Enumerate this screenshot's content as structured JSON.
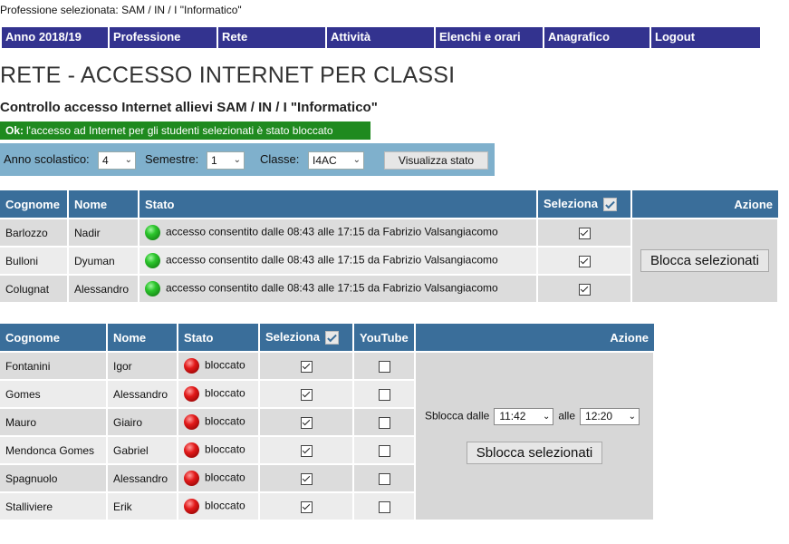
{
  "header": {
    "profession_info": "Professione selezionata: SAM / IN / I  \"Informatico\""
  },
  "nav": [
    {
      "label": "Anno 2018/19"
    },
    {
      "label": "Professione"
    },
    {
      "label": "Rete"
    },
    {
      "label": "Attività"
    },
    {
      "label": "Elenchi e orari"
    },
    {
      "label": "Anagrafico"
    },
    {
      "label": "Logout"
    }
  ],
  "page": {
    "title": "RETE - ACCESSO INTERNET PER CLASSI",
    "subtitle": "Controllo accesso Internet allievi SAM / IN / I  \"Informatico\"",
    "ok_prefix": "Ok:",
    "ok_message": "l'accesso ad Internet per gli studenti selezionati è stato bloccato"
  },
  "filters": {
    "anno_label": "Anno scolastico:",
    "anno_value": "4",
    "semestre_label": "Semestre:",
    "semestre_value": "1",
    "classe_label": "Classe:",
    "classe_value": "I4AC",
    "view_button": "Visualizza stato"
  },
  "allowed_table": {
    "headers": {
      "cognome": "Cognome",
      "nome": "Nome",
      "stato": "Stato",
      "seleziona": "Seleziona",
      "azione": "Azione"
    },
    "rows": [
      {
        "cognome": "Barlozzo",
        "nome": "Nadir",
        "stato": "accesso consentito dalle 08:43 alle 17:15 da Fabrizio Valsangiacomo",
        "checked": true
      },
      {
        "cognome": "Bulloni",
        "nome": "Dyuman",
        "stato": "accesso consentito dalle 08:43 alle 17:15 da Fabrizio Valsangiacomo",
        "checked": true
      },
      {
        "cognome": "Colugnat",
        "nome": "Alessandro",
        "stato": "accesso consentito dalle 08:43 alle 17:15 da Fabrizio Valsangiacomo",
        "checked": true
      }
    ],
    "action_button": "Blocca selezionati"
  },
  "blocked_table": {
    "headers": {
      "cognome": "Cognome",
      "nome": "Nome",
      "stato": "Stato",
      "seleziona": "Seleziona",
      "youtube": "YouTube",
      "azione": "Azione"
    },
    "rows": [
      {
        "cognome": "Fontanini",
        "nome": "Igor",
        "stato": "bloccato",
        "checked": true,
        "youtube": false
      },
      {
        "cognome": "Gomes",
        "nome": "Alessandro",
        "stato": "bloccato",
        "checked": true,
        "youtube": false
      },
      {
        "cognome": "Mauro",
        "nome": "Giairo",
        "stato": "bloccato",
        "checked": true,
        "youtube": false
      },
      {
        "cognome": "Mendonca Gomes",
        "nome": "Gabriel",
        "stato": "bloccato",
        "checked": true,
        "youtube": false
      },
      {
        "cognome": "Spagnuolo",
        "nome": "Alessandro",
        "stato": "bloccato",
        "checked": true,
        "youtube": false
      },
      {
        "cognome": "Stalliviere",
        "nome": "Erik",
        "stato": "bloccato",
        "checked": true,
        "youtube": false
      }
    ],
    "sblocca_from_label": "Sblocca dalle",
    "sblocca_from_value": "11:42",
    "sblocca_to_label": "alle",
    "sblocca_to_value": "12:20",
    "action_button": "Sblocca selezionati"
  },
  "colors": {
    "nav_bg": "#33338f",
    "table_header": "#3a6e9a",
    "ok_green": "#1f8a1f",
    "filter_bg": "#7fb0cc"
  },
  "icons": {
    "allowed_status": "green-light-icon",
    "blocked_status": "red-light-icon"
  }
}
